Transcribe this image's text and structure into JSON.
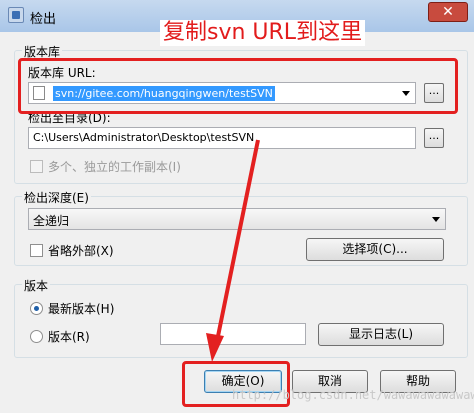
{
  "window": {
    "title": "检出",
    "close_symbol": "✕"
  },
  "annotation": {
    "text": "复制svn URL到这里",
    "color": "#e21b1b"
  },
  "repository": {
    "group_label": "版本库",
    "url_label": "版本库 URL:",
    "url_value": "svn://gitee.com/huangqingwen/testSVN",
    "browse_label": "...",
    "checkout_dir_label": "检出至目录(D):",
    "checkout_dir_value": "C:\\Users\\Administrator\\Desktop\\testSVN",
    "checkout_browse_label": "...",
    "multi_wc_label": "多个、独立的工作副本(I)"
  },
  "depth": {
    "group_label": "检出深度(E)",
    "selected": "全递归",
    "omit_externals_label": "省略外部(X)",
    "options_button": "选择项(C)..."
  },
  "revision": {
    "group_label": "版本",
    "head_label": "最新版本(H)",
    "rev_label": "版本(R)",
    "rev_value": "",
    "show_log_button": "显示日志(L)"
  },
  "buttons": {
    "ok": "确定(O)",
    "cancel": "取消",
    "help": "帮助"
  },
  "watermark": "http://blog.csdn.net/wawawawawawawa",
  "colors": {
    "highlight": "#e32020",
    "selection": "#3399ff"
  }
}
